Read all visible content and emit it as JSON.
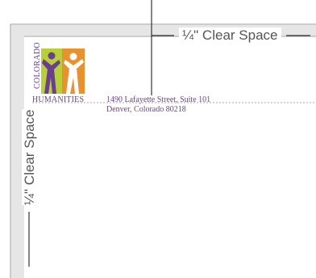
{
  "clear_space": {
    "top_label": "¼\" Clear Space",
    "left_label": "¼\" Clear Space"
  },
  "logo": {
    "wordmark_vertical": "COLORADO",
    "wordmark_horizontal": "HUMANITIES",
    "colors": {
      "lime": "#b8cf3a",
      "orange": "#e8922f",
      "purple": "#6a3f8f",
      "white": "#ffffff"
    }
  },
  "address": {
    "line1": "1490 Lafayette Street, Suite 101",
    "line2": "Denver, Colorado 80218"
  },
  "colors": {
    "guide_line": "#555555",
    "page_edge": "#999999",
    "dashed_rule": "#888888"
  }
}
